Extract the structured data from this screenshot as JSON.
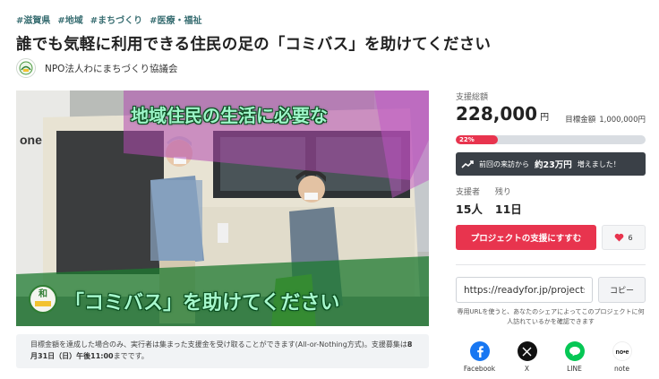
{
  "tags": [
    "#滋賀県",
    "#地域",
    "#まちづくり",
    "#医療・福祉"
  ],
  "title": "誰でも気軽に利用できる住民の足の「コミバス」を助けてください",
  "organization": {
    "name": "NPO法人わにまちづくり協議会"
  },
  "hero": {
    "caption_top": "地域住民の生活に必要な",
    "caption_bottom": "「コミバス」を助けてください",
    "side_text": "one",
    "badge_text": "和"
  },
  "notice": {
    "text": "目標金額を達成した場合のみ、実行者は集まった支援金を受け取ることができます(All-or-Nothing方式)。支援募集は",
    "deadline": "8月31日（日）午後11:00",
    "suffix": "までです。"
  },
  "funding": {
    "total_label": "支援総額",
    "total_amount": "228,000",
    "total_unit": "円",
    "goal_label": "目標金額",
    "goal_amount": "1,000,000円",
    "progress_label": "22%",
    "progress_fraction": 0.22,
    "growth_prefix": "前回の来訪から",
    "growth_amount": "約23万円",
    "growth_suffix": "増えました！"
  },
  "stats": {
    "supporters_label": "支援者",
    "supporters_value": "15人",
    "remaining_label": "残り",
    "remaining_value": "11日"
  },
  "actions": {
    "support_button": "プロジェクトの支援にすすむ",
    "favorite_count": "6"
  },
  "share": {
    "url_value": "https://readyfor.jp/projects/...",
    "copy_button": "コピー",
    "note": "専用URLを使うと、あなたのシェアによってこのプロジェクトに何人訪れているかを確認できます",
    "items": [
      {
        "label": "Facebook",
        "icon": "facebook-icon",
        "color": "#1877f2"
      },
      {
        "label": "X",
        "icon": "x-icon",
        "color": "#111111"
      },
      {
        "label": "LINE",
        "icon": "line-icon",
        "color": "#06c755"
      },
      {
        "label": "note",
        "icon": "note-icon",
        "color": "#ffffff"
      }
    ]
  },
  "colors": {
    "accent": "#e8344e",
    "tag": "#3a6f73",
    "dark_banner": "#3a4047"
  }
}
